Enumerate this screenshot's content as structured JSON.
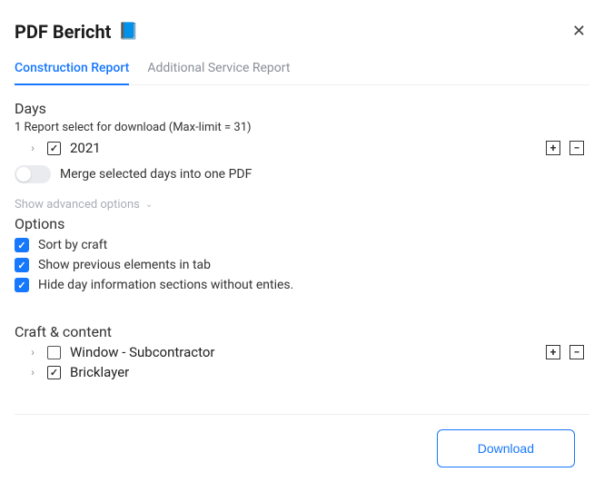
{
  "header": {
    "title": "PDF Bericht",
    "icon": "📘"
  },
  "tabs": [
    {
      "label": "Construction Report",
      "active": true
    },
    {
      "label": "Additional Service Report",
      "active": false
    }
  ],
  "days": {
    "title": "Days",
    "subtext": "1 Report select for download  (Max-limit = 31)",
    "year_label": "2021",
    "year_checked": true,
    "merge_label": "Merge selected days into one PDF",
    "merge_on": false
  },
  "advanced": {
    "label": "Show advanced options"
  },
  "options": {
    "title": "Options",
    "items": [
      {
        "label": "Sort by craft",
        "checked": true
      },
      {
        "label": "Show previous elements in tab",
        "checked": true
      },
      {
        "label": "Hide day information sections without enties.",
        "checked": true
      }
    ]
  },
  "craft": {
    "title": "Craft & content",
    "items": [
      {
        "label": "Window - Subcontractor",
        "checked": false
      },
      {
        "label": "Bricklayer",
        "checked": true
      }
    ]
  },
  "footer": {
    "download_label": "Download"
  }
}
